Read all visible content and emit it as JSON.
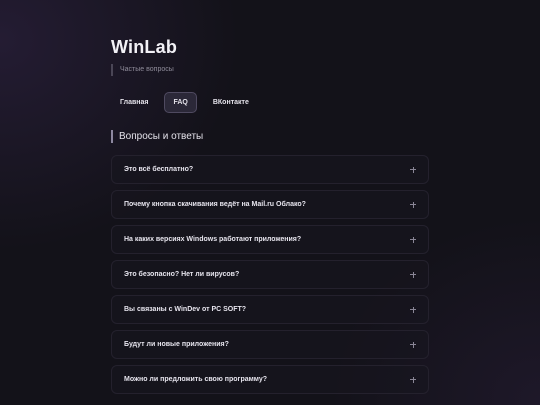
{
  "brand": {
    "logo": "WinLab",
    "tagline": "Частые вопросы"
  },
  "nav": {
    "items": [
      {
        "label": "Главная",
        "active": false
      },
      {
        "label": "FAQ",
        "active": true
      },
      {
        "label": "ВКонтакте",
        "active": false
      }
    ]
  },
  "section": {
    "title": "Вопросы и ответы"
  },
  "faq": {
    "items": [
      {
        "question": "Это всё бесплатно?"
      },
      {
        "question": "Почему кнопка скачивания ведёт на Mail.ru Облако?"
      },
      {
        "question": "На каких версиях Windows работают приложения?"
      },
      {
        "question": "Это безопасно? Нет ли вирусов?"
      },
      {
        "question": "Вы связаны с WinDev от PC SOFT?"
      },
      {
        "question": "Будут ли новые приложения?"
      },
      {
        "question": "Можно ли предложить свою программу?"
      }
    ]
  },
  "colors": {
    "background": "#131219",
    "active_nav_bg": "#2b2838",
    "card_border": "#24212d"
  }
}
